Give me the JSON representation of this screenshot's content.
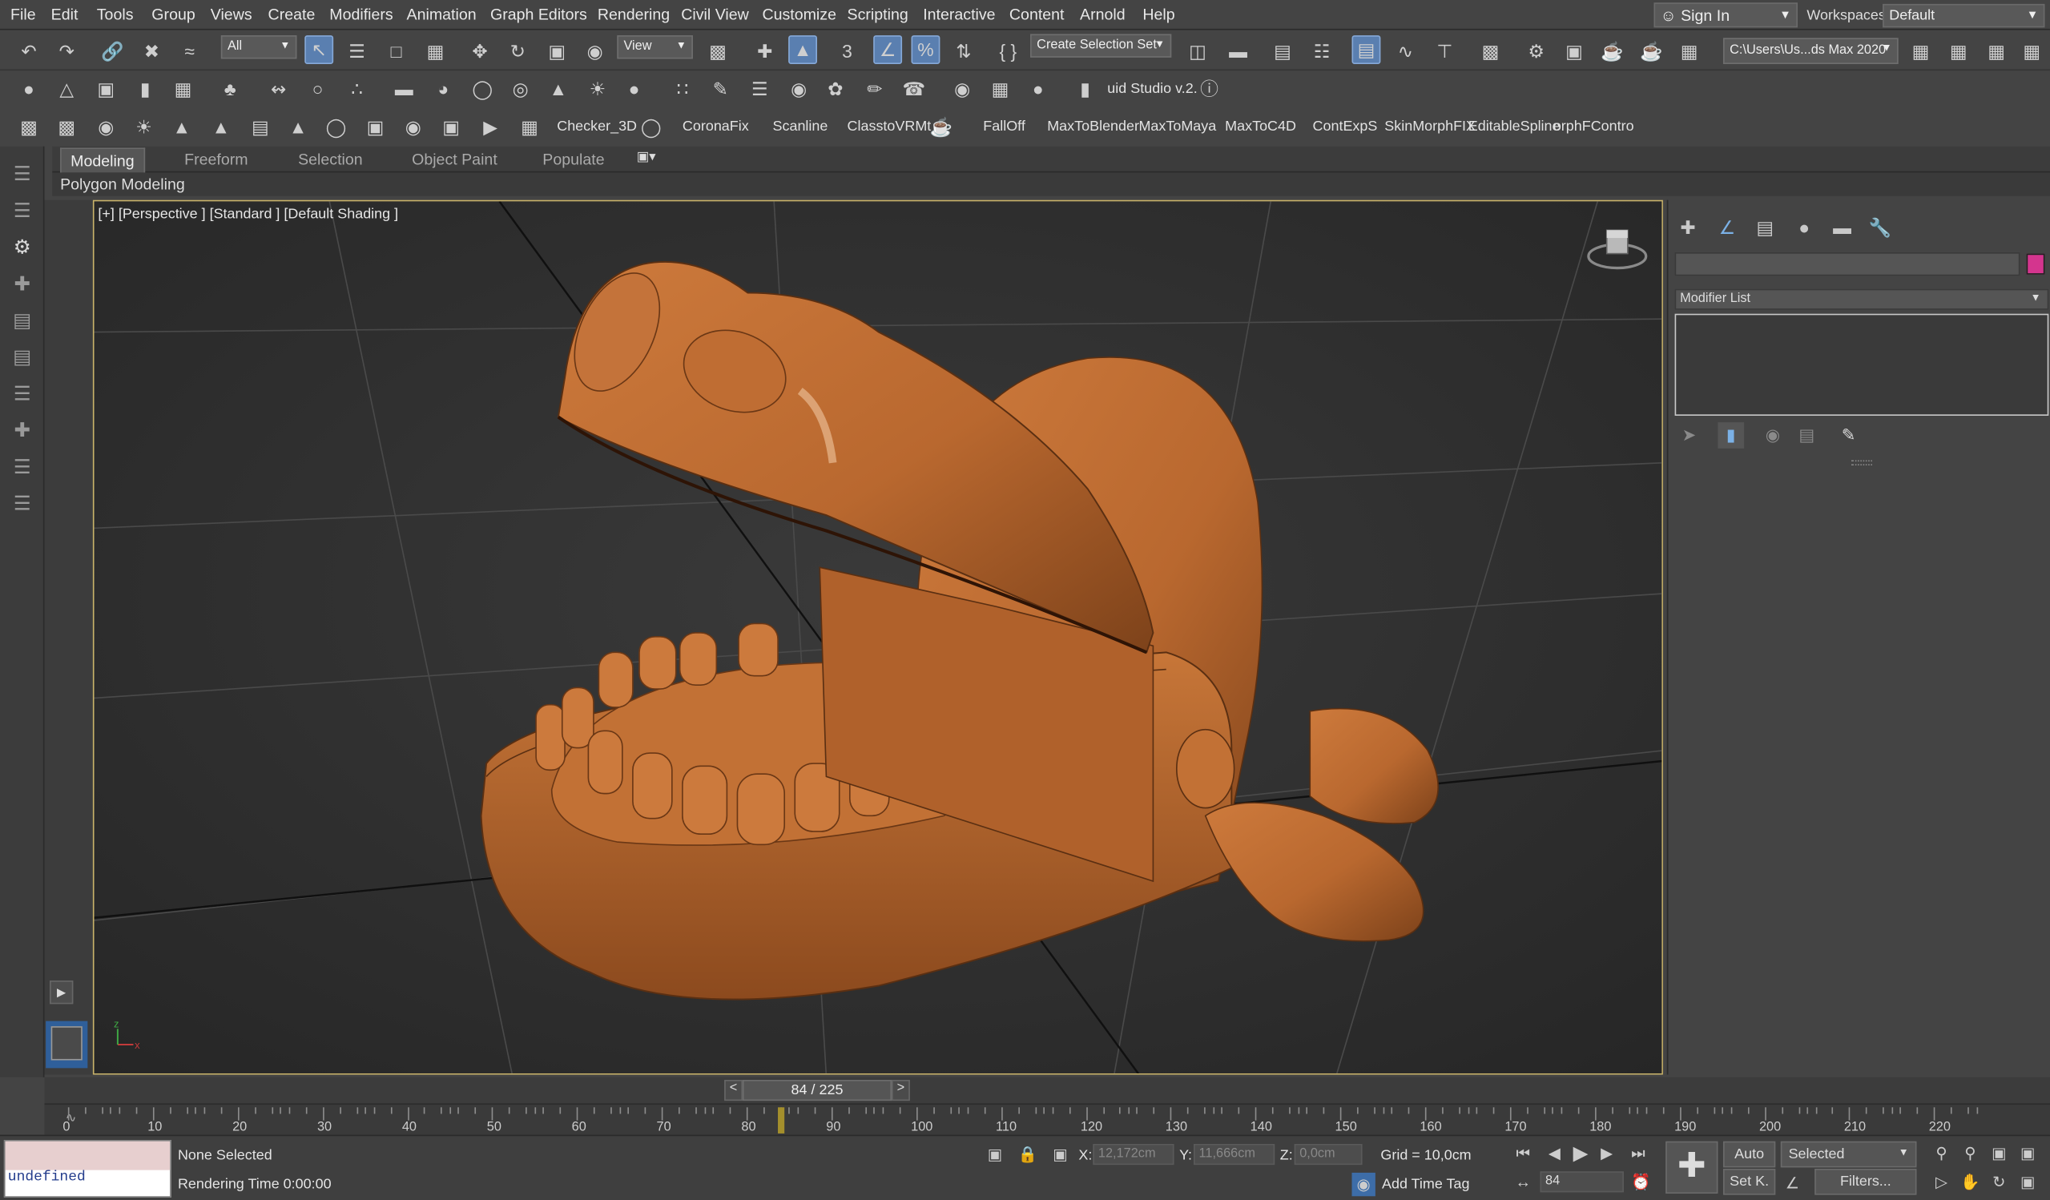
{
  "menu": [
    "File",
    "Edit",
    "Tools",
    "Group",
    "Views",
    "Create",
    "Modifiers",
    "Animation",
    "Graph Editors",
    "Rendering",
    "Civil View",
    "Customize",
    "Scripting",
    "Interactive",
    "Content",
    "Arnold",
    "Help"
  ],
  "account": {
    "sign_in": "Sign In",
    "workspaces_label": "Workspaces:",
    "workspace": "Default"
  },
  "main_toolbar": {
    "selection_filter": "All",
    "ref_coord": "View",
    "snap_value": "3",
    "selection_set": "Create Selection Set",
    "project_path": "C:\\Users\\Us...ds Max 2020"
  },
  "toolbar2": {
    "fluid_studio": "uid Studio v.2."
  },
  "toolbar3": {
    "buttons": [
      "Checker_3D",
      "CoronaFix",
      "Scanline",
      "ClasstoVRMt",
      "FallOff",
      "MaxToBlender",
      "MaxToMaya",
      "MaxToC4D",
      "ContExpS",
      "SkinMorphFIX",
      "EditableSpline",
      "orphFControlli"
    ]
  },
  "ribbon": {
    "tabs": [
      "Modeling",
      "Freeform",
      "Selection",
      "Object Paint",
      "Populate"
    ],
    "panel": "Polygon Modeling"
  },
  "viewport": {
    "label": "[+] [Perspective ] [Standard ] [Default Shading ]",
    "object_color": "#b9682f"
  },
  "command_panel": {
    "modifier_list": "Modifier List",
    "object_color": "#d4358e"
  },
  "timeline": {
    "frame_display": "84 / 225",
    "current_frame": 84,
    "total_frames": 225,
    "ticks": [
      "0",
      "10",
      "20",
      "30",
      "40",
      "50",
      "60",
      "70",
      "80",
      "90",
      "100",
      "110",
      "120",
      "130",
      "140",
      "150",
      "160",
      "170",
      "180",
      "190",
      "200",
      "210",
      "220"
    ]
  },
  "status": {
    "maxscript_output": "undefined",
    "selection": "None Selected",
    "rendering_time": "Rendering Time  0:00:00",
    "x_label": "X:",
    "x_value": "12,172cm",
    "y_label": "Y:",
    "y_value": "11,666cm",
    "z_label": "Z:",
    "z_value": "0,0cm",
    "grid": "Grid = 10,0cm",
    "add_time_tag": "Add Time Tag",
    "frame": "84",
    "auto_key": "Auto",
    "set_key": "Set K.",
    "key_filter": "Selected",
    "filters": "Filters..."
  }
}
